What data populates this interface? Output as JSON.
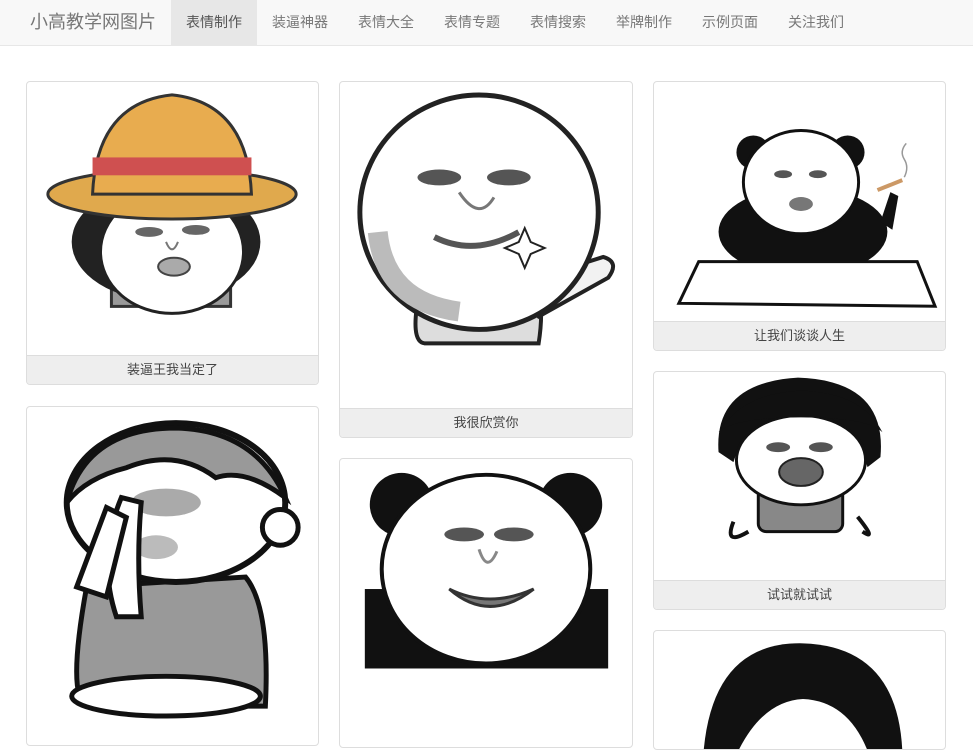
{
  "navbar": {
    "brand": "小高教学网图片",
    "items": [
      {
        "label": "表情制作",
        "active": true
      },
      {
        "label": "装逼神器",
        "active": false
      },
      {
        "label": "表情大全",
        "active": false
      },
      {
        "label": "表情专题",
        "active": false
      },
      {
        "label": "表情搜索",
        "active": false
      },
      {
        "label": "举牌制作",
        "active": false
      },
      {
        "label": "示例页面",
        "active": false
      },
      {
        "label": "关注我们",
        "active": false
      }
    ]
  },
  "gallery": {
    "cards": [
      {
        "caption": "装逼王我当定了",
        "image": "straw-hat-meme-image"
      },
      {
        "caption": "我很欣赏你",
        "image": "pointing-face-meme-image"
      },
      {
        "caption": "让我们谈谈人生",
        "image": "panda-smoking-meme-image"
      },
      {
        "caption": "",
        "image": "praying-boy-meme-image"
      },
      {
        "caption": "",
        "image": "laughing-panda-meme-image"
      },
      {
        "caption": "试试就试试",
        "image": "bowl-cut-laughing-meme-image"
      },
      {
        "caption": "",
        "image": "bowl-cut-partial-meme-image"
      }
    ]
  }
}
